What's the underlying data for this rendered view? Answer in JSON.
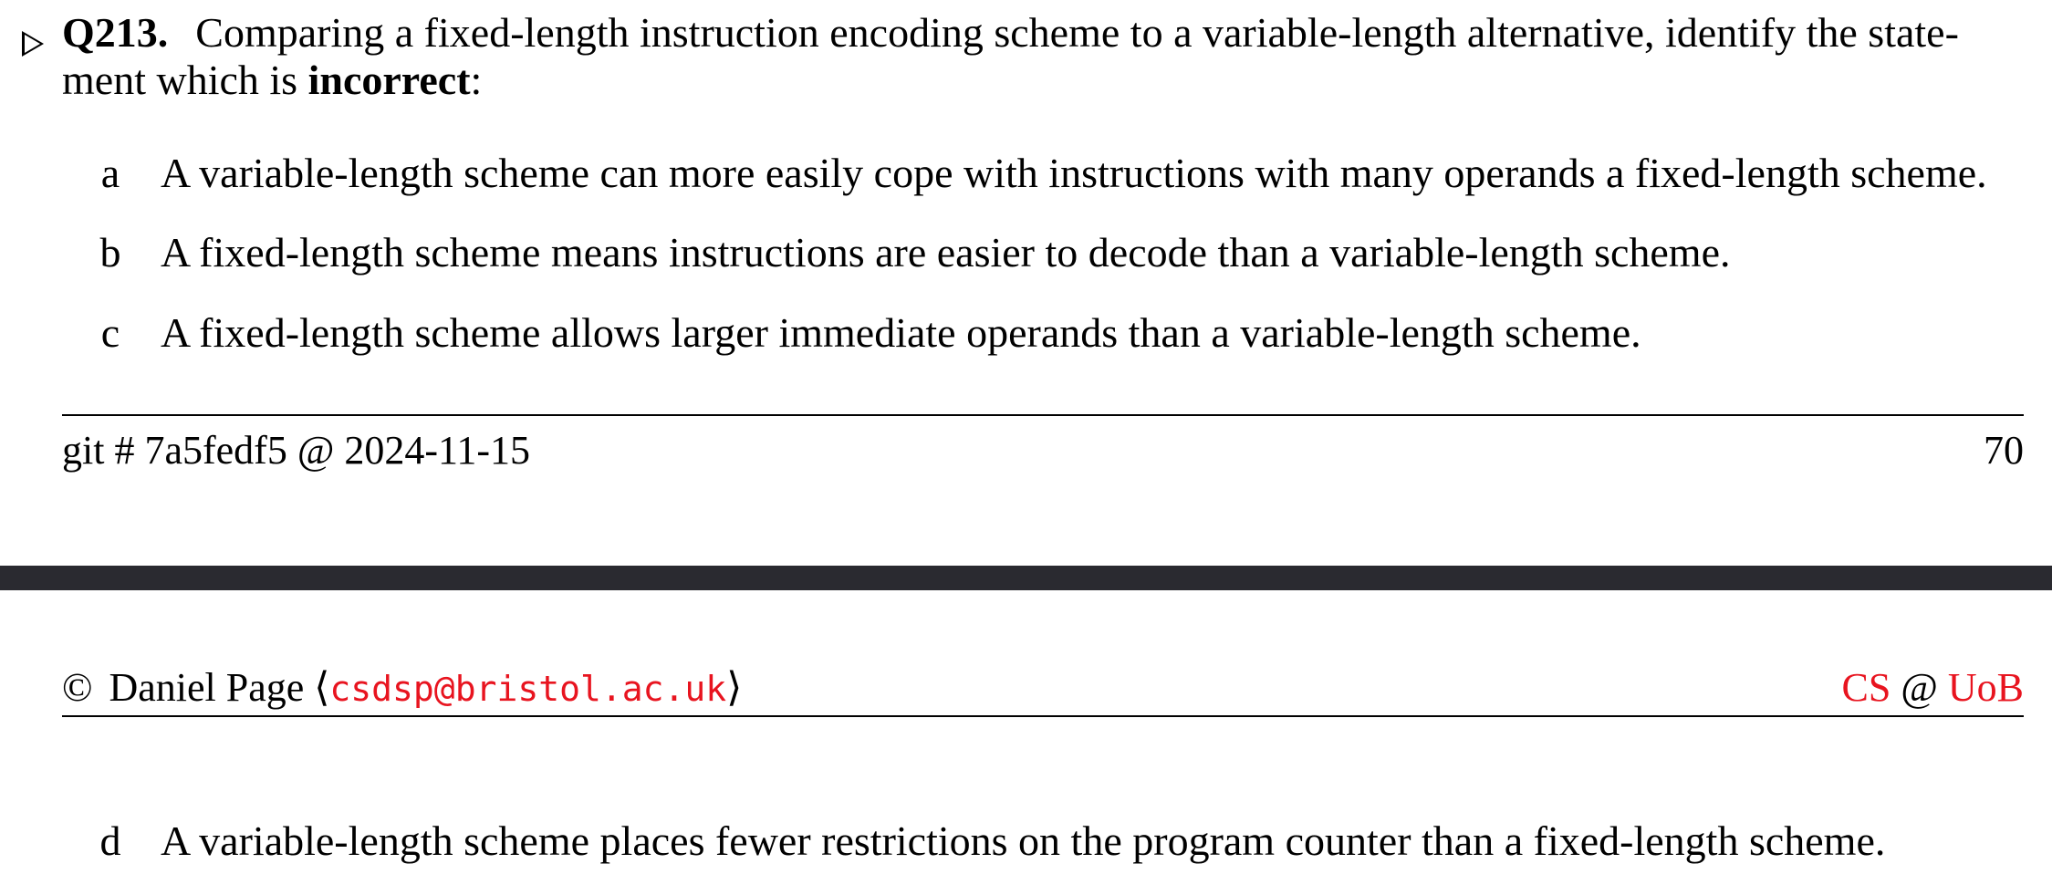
{
  "question": {
    "number": "Q213.",
    "text_before": "Comparing a fixed-length instruction encoding scheme to a variable-length alternative, identify the state-ment which is ",
    "emphasis": "incorrect",
    "text_after": ":"
  },
  "options": [
    {
      "letter": "a",
      "text": "A variable-length scheme can more easily cope with instructions with many operands a fixed-length scheme."
    },
    {
      "letter": "b",
      "text": "A fixed-length scheme means instructions are easier to decode than a variable-length scheme."
    },
    {
      "letter": "c",
      "text": "A fixed-length scheme allows larger immediate operands than a variable-length scheme."
    },
    {
      "letter": "d",
      "text": "A variable-length scheme places fewer restrictions on the program counter than a fixed-length scheme."
    }
  ],
  "footer": {
    "git": "git # 7a5fedf5 @ 2024-11-15",
    "page": "70"
  },
  "header": {
    "copyright": "©",
    "author": "Daniel Page",
    "open_bracket": "⟨",
    "email": "csdsp@bristol.ac.uk",
    "close_bracket": "⟩",
    "dept": "CS",
    "at": "@",
    "uni": "UoB"
  },
  "colors": {
    "link_red": "#e8141f",
    "band": "#2a2a30"
  }
}
